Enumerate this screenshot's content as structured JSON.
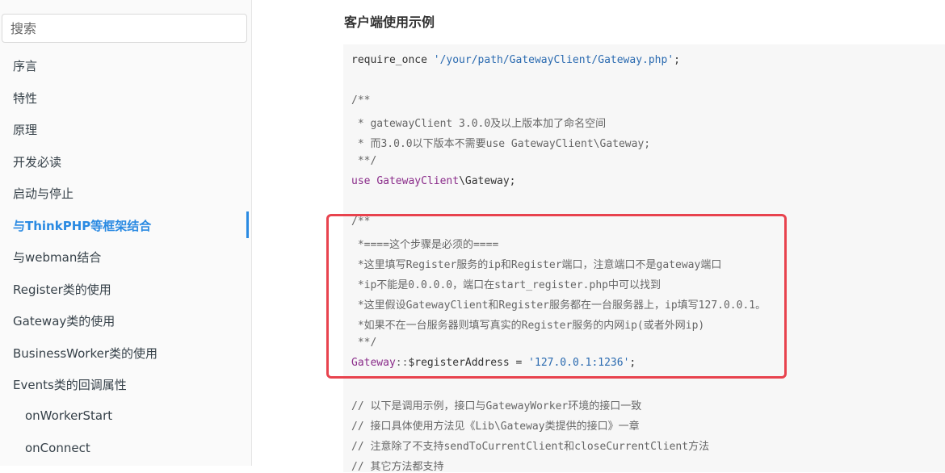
{
  "sidebar": {
    "search_placeholder": "搜索",
    "items": [
      {
        "label": "序言"
      },
      {
        "label": "特性"
      },
      {
        "label": "原理"
      },
      {
        "label": "开发必读"
      },
      {
        "label": "启动与停止"
      },
      {
        "label": "与ThinkPHP等框架结合",
        "active": true
      },
      {
        "label": "与webman结合"
      },
      {
        "label": "Register类的使用"
      },
      {
        "label": "Gateway类的使用"
      },
      {
        "label": "BusinessWorker类的使用"
      },
      {
        "label": "Events类的回调属性"
      },
      {
        "label": "onWorkerStart",
        "sub": true
      },
      {
        "label": "onConnect",
        "sub": true
      }
    ]
  },
  "main": {
    "heading": "客户端使用示例",
    "code": {
      "require_kw": "require_once",
      "require_path": "'/your/path/GatewayClient/Gateway.php'",
      "require_end": ";",
      "c1": "/**",
      "c2": " * gatewayClient 3.0.0及以上版本加了命名空间",
      "c3": " * 而3.0.0以下版本不需要use GatewayClient\\Gateway;",
      "c4": " **/",
      "use_kw": "use",
      "use_ns": "GatewayClient",
      "use_rest": "\\Gateway;",
      "h1": "/**",
      "h2": " *====这个步骤是必须的====",
      "h3": " *这里填写Register服务的ip和Register端口，注意端口不是gateway端口",
      "h4": " *ip不能是0.0.0.0，端口在start_register.php中可以找到",
      "h5": " *这里假设GatewayClient和Register服务都在一台服务器上，ip填写127.0.0.1。",
      "h6": " *如果不在一台服务器则填写真实的Register服务的内网ip(或者外网ip)",
      "h7": " **/",
      "assign_cls": "Gateway",
      "assign_op": "::",
      "assign_var": "$registerAddress = ",
      "assign_val": "'127.0.0.1:1236'",
      "assign_end": ";",
      "t1": "// 以下是调用示例，接口与GatewayWorker环境的接口一致",
      "t2": "// 接口具体使用方法见《Lib\\Gateway类提供的接口》一章",
      "t3": "// 注意除了不支持sendToCurrentClient和closeCurrentClient方法",
      "t4": "// 其它方法都支持"
    }
  },
  "colors": {
    "accent": "#2a8ae2",
    "highlight_border": "#e8434e",
    "code_bg": "#f7f7f7"
  }
}
